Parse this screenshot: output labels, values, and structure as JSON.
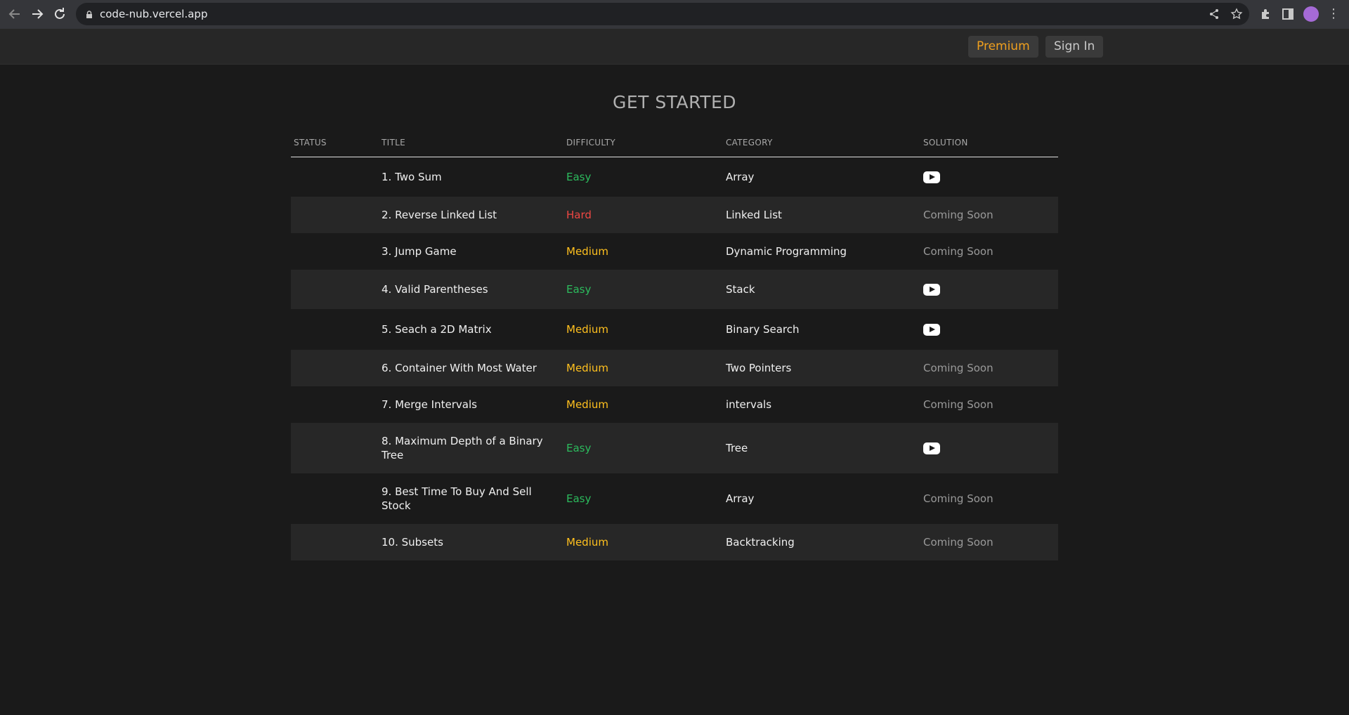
{
  "browser": {
    "url": "code-nub.vercel.app"
  },
  "header": {
    "premium_label": "Premium",
    "signin_label": "Sign In"
  },
  "page": {
    "title": "GET STARTED"
  },
  "table": {
    "headers": {
      "status": "STATUS",
      "title": "TITLE",
      "difficulty": "DIFFICULTY",
      "category": "CATEGORY",
      "solution": "SOLUTION"
    },
    "rows": [
      {
        "title": "1. Two Sum",
        "difficulty": "Easy",
        "category": "Array",
        "solution": "video",
        "solution_text": ""
      },
      {
        "title": "2. Reverse Linked List",
        "difficulty": "Hard",
        "category": "Linked List",
        "solution": "text",
        "solution_text": "Coming Soon"
      },
      {
        "title": "3. Jump Game",
        "difficulty": "Medium",
        "category": "Dynamic Programming",
        "solution": "text",
        "solution_text": "Coming Soon"
      },
      {
        "title": "4. Valid Parentheses",
        "difficulty": "Easy",
        "category": "Stack",
        "solution": "video",
        "solution_text": ""
      },
      {
        "title": "5. Seach a 2D Matrix",
        "difficulty": "Medium",
        "category": "Binary Search",
        "solution": "video",
        "solution_text": ""
      },
      {
        "title": "6. Container With Most Water",
        "difficulty": "Medium",
        "category": "Two Pointers",
        "solution": "text",
        "solution_text": "Coming Soon"
      },
      {
        "title": "7. Merge Intervals",
        "difficulty": "Medium",
        "category": "intervals",
        "solution": "text",
        "solution_text": "Coming Soon"
      },
      {
        "title": "8. Maximum Depth of a Binary Tree",
        "difficulty": "Easy",
        "category": "Tree",
        "solution": "video",
        "solution_text": ""
      },
      {
        "title": "9. Best Time To Buy And Sell Stock",
        "difficulty": "Easy",
        "category": "Array",
        "solution": "text",
        "solution_text": "Coming Soon"
      },
      {
        "title": "10. Subsets",
        "difficulty": "Medium",
        "category": "Backtracking",
        "solution": "text",
        "solution_text": "Coming Soon"
      }
    ]
  },
  "colors": {
    "easy": "#2cbb5d",
    "medium": "#ffc01e",
    "hard": "#ef4743",
    "premium": "#f0a01e"
  },
  "icons": {
    "solution_video": "youtube-play-icon"
  }
}
